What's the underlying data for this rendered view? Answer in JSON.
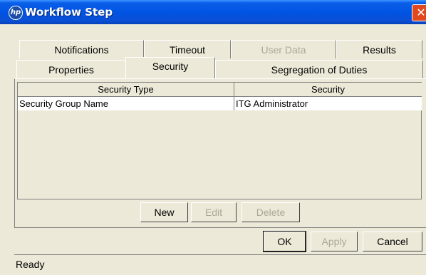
{
  "window": {
    "title": "Workflow Step",
    "close_glyph": "✕",
    "icon": "hp-logo"
  },
  "tabs_row1": [
    {
      "label": "Notifications",
      "disabled": false
    },
    {
      "label": "Timeout",
      "disabled": false
    },
    {
      "label": "User Data",
      "disabled": true
    },
    {
      "label": "Results",
      "disabled": false
    }
  ],
  "tabs_row2": [
    {
      "label": "Properties",
      "selected": false
    },
    {
      "label": "Security",
      "selected": true
    },
    {
      "label": "Segregation of Duties",
      "selected": false
    }
  ],
  "table": {
    "columns": [
      "Security Type",
      "Security"
    ],
    "rows": [
      [
        "Security Group Name",
        "ITG Administrator"
      ]
    ]
  },
  "table_buttons": {
    "new": "New",
    "edit": "Edit",
    "delete": "Delete"
  },
  "dialog_buttons": {
    "ok": "OK",
    "apply": "Apply",
    "cancel": "Cancel"
  },
  "status": "Ready"
}
